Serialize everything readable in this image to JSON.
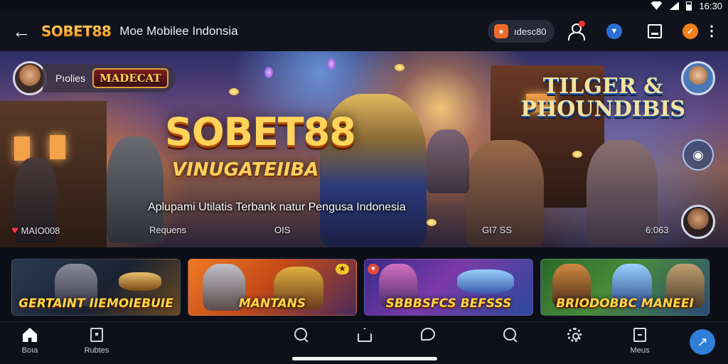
{
  "status": {
    "time": "16:30"
  },
  "appbar": {
    "brand": "SOBET88",
    "title": "Moe Mobilee Indonsia",
    "pill_text": "ıdesc80"
  },
  "hero": {
    "promo_label": "Pıolies",
    "badge_logo": "MADECAT",
    "title": "SOBET88",
    "subtitle": "VINUGATEIIBA",
    "tagline": "Aplupami Utilatis Terbank natur Pengusa Indonesia",
    "right_logo_line1": "TILGER &",
    "right_logo_line2": "PHOUNDIBIS",
    "stats": [
      {
        "text": "MAIO008"
      },
      {
        "text": "Requens"
      },
      {
        "text": "OIS"
      },
      {
        "text": "GI7 SS"
      },
      {
        "text": "6:063"
      }
    ]
  },
  "cards": [
    {
      "title": "GERTAINT IIEMOIEBUIE",
      "badge": ""
    },
    {
      "title": "MANTANS",
      "badge": ""
    },
    {
      "title": "SBBBSFCS BEFSSS",
      "badge": ""
    },
    {
      "title": "BRIODOBBC MANEEI",
      "badge": ""
    }
  ],
  "nav": {
    "home": "Boıa",
    "bag": "Rubtes",
    "menu": "Meus"
  },
  "colors": {
    "accent_gold": "#ffd45a",
    "badge_red": "#ee3344",
    "fab_blue": "#2f7fd9",
    "pill_orange": "#ef6a2a"
  },
  "icons": [
    "back-arrow-icon",
    "user-icon",
    "notification-icon",
    "square-icon",
    "orange-app-icon",
    "kebab-icon",
    "home-icon",
    "bag-icon",
    "search-icon",
    "house-icon",
    "chat-icon",
    "gear-icon",
    "menu-icon",
    "fab-icon"
  ]
}
